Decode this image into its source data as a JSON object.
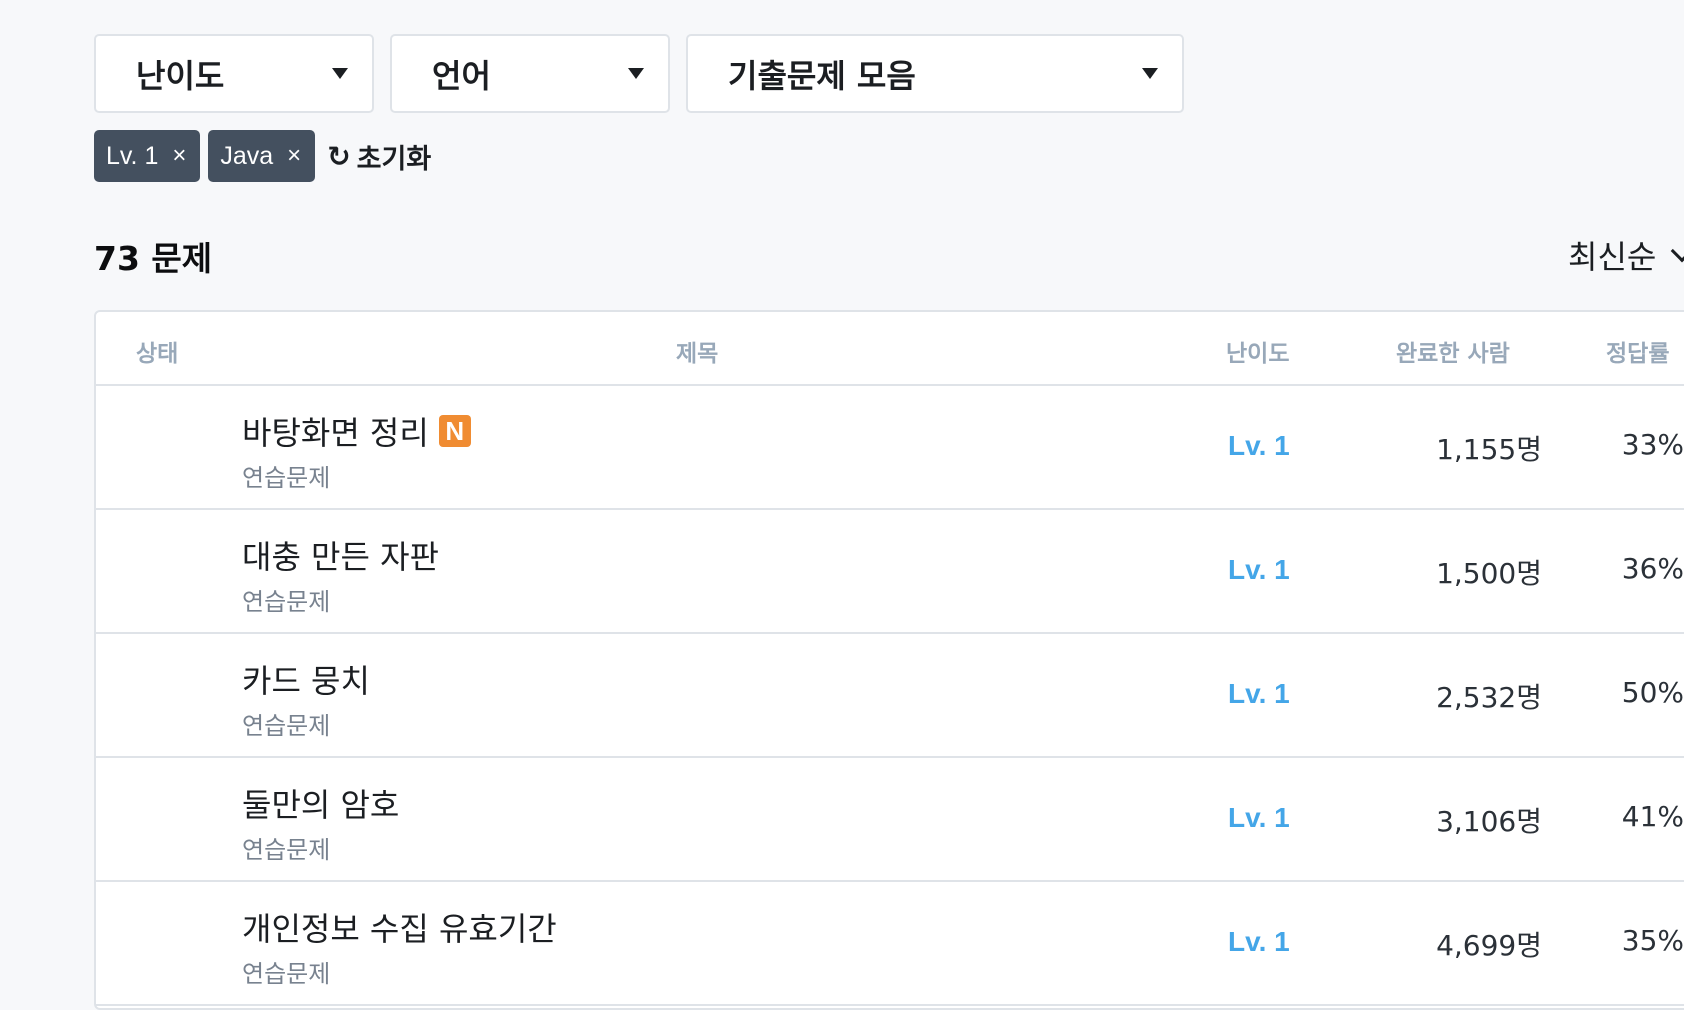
{
  "filters": {
    "difficulty_label": "난이도",
    "language_label": "언어",
    "collection_label": "기출문제 모음"
  },
  "chips": [
    {
      "label": "Lv. 1",
      "remove": "×"
    },
    {
      "label": "Java",
      "remove": "×"
    }
  ],
  "reset": {
    "icon": "refresh-icon",
    "glyph": "↻",
    "label": "초기화"
  },
  "summary": {
    "count": "73 문제"
  },
  "sort": {
    "label": "최신순"
  },
  "table": {
    "headers": {
      "status": "상태",
      "title": "제목",
      "level": "난이도",
      "completed": "완료한 사람",
      "rate": "정답률"
    },
    "rows": [
      {
        "title": "바탕화면 정리",
        "badge": "N",
        "subtitle": "연습문제",
        "level": "Lv. 1",
        "completed": "1,155명",
        "rate": "33%"
      },
      {
        "title": "대충 만든 자판",
        "subtitle": "연습문제",
        "level": "Lv. 1",
        "completed": "1,500명",
        "rate": "36%"
      },
      {
        "title": "카드 뭉치",
        "subtitle": "연습문제",
        "level": "Lv. 1",
        "completed": "2,532명",
        "rate": "50%"
      },
      {
        "title": "둘만의 암호",
        "subtitle": "연습문제",
        "level": "Lv. 1",
        "completed": "3,106명",
        "rate": "41%"
      },
      {
        "title": "개인정보 수집 유효기간",
        "subtitle": "연습문제",
        "level": "Lv. 1",
        "completed": "4,699명",
        "rate": "35%"
      }
    ]
  },
  "colors": {
    "chip_bg": "#44505f",
    "level_text": "#44a6e8",
    "new_badge": "#f08c32",
    "header_text": "#98a8b9"
  }
}
